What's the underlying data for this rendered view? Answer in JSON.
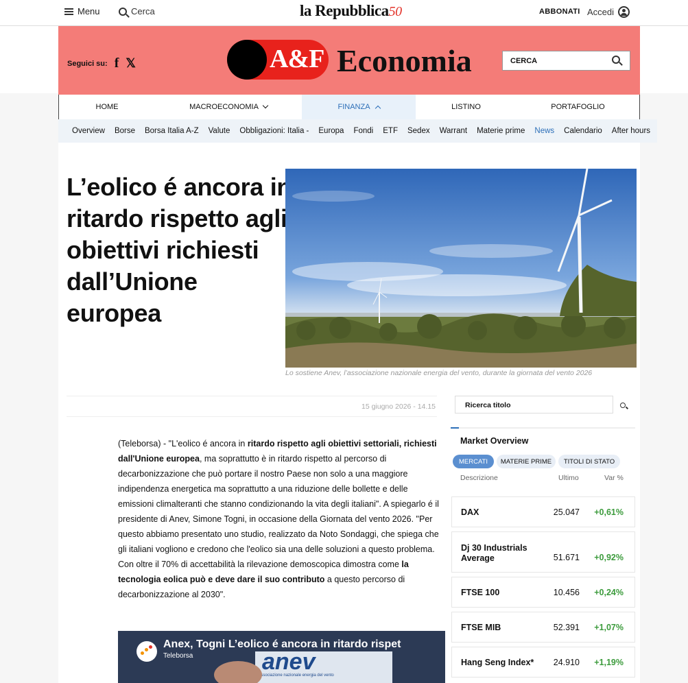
{
  "topbar": {
    "menu_label": "Menu",
    "search_label": "Cerca",
    "logo_text": "la Repubblica",
    "logo_suffix": "50",
    "subscribe_label": "ABBONATI",
    "login_label": "Accedi"
  },
  "section_header": {
    "follow_label": "Seguici su:",
    "facebook_glyph": "f",
    "x_glyph": "𝕏",
    "brand_mark": "A&F",
    "brand_name": "Economia",
    "search_placeholder": "CERCA"
  },
  "main_nav": [
    {
      "label": "HOME",
      "dropdown": false,
      "active": false
    },
    {
      "label": "MACROECONOMIA",
      "dropdown": true,
      "active": false
    },
    {
      "label": "FINANZA",
      "dropdown": true,
      "active": true
    },
    {
      "label": "LISTINO",
      "dropdown": false,
      "active": false
    },
    {
      "label": "PORTAFOGLIO",
      "dropdown": false,
      "active": false
    }
  ],
  "sub_nav": [
    "Overview",
    "Borse",
    "Borsa Italia A-Z",
    "Valute",
    "Obbligazioni: Italia -",
    "Europa",
    "Fondi",
    "ETF",
    "Sedex",
    "Warrant",
    "Materie prime",
    "News",
    "Calendario",
    "After hours"
  ],
  "sub_nav_active": "News",
  "article": {
    "title": "L’eolico é ancora in ritardo rispetto agli obiettivi richiesti dall’Unione europea",
    "image_caption": "Lo sostiene Anev, l’associazione nazionale energia del vento, durante la giornata del vento 2026",
    "date": "15 giugno 2026 - 14.15",
    "body": [
      {
        "t": "(Teleborsa) - \"L'eolico é ancora in ",
        "b": false
      },
      {
        "t": "ritardo rispetto agli obiettivi settoriali, richiesti dall'Unione europea",
        "b": true
      },
      {
        "t": ", ma soprattutto è in ritardo rispetto al percorso di decarbonizzazione che può portare il nostro Paese non solo a una maggiore indipendenza energetica ma soprattutto a una riduzione delle bollette e delle emissioni climalteranti che stanno condizionando la vita degli italiani\". A spiegarlo é il presidente di Anev, Simone Togni, in occasione della Giornata del vento 2026. \"Per questo abbiamo presentato uno studio, realizzato da Noto Sondaggi, che spiega che gli italiani vogliono e credono che l'eolico sia una delle soluzioni a questo problema. Con oltre il 70% di accettabilità la rilevazione demoscopica dimostra come ",
        "b": false
      },
      {
        "t": "la tecnologia eolica può e deve dare il suo contributo",
        "b": true
      },
      {
        "t": " a questo percorso di decarbonizzazione al 2030\".",
        "b": false
      }
    ],
    "video": {
      "title": "Anex, Togni L’eolico é ancora in ritardo rispet",
      "channel": "Teleborsa",
      "sign_text": "anev",
      "sign_sub": "associazione nazionale energia del vento"
    }
  },
  "sidebar": {
    "search_placeholder": "Ricerca titolo",
    "market_title": "Market Overview",
    "tabs": [
      {
        "label": "MERCATI",
        "active": true
      },
      {
        "label": "MATERIE PRIME",
        "active": false
      },
      {
        "label": "TITOLI DI STATO",
        "active": false
      }
    ],
    "columns": [
      "Descrizione",
      "Ultimo",
      "Var %"
    ],
    "rows": [
      {
        "name": "DAX",
        "last": "25.047",
        "change": "+0,61%"
      },
      {
        "name": "Dj 30 Industrials Average",
        "last": "51.671",
        "change": "+0,92%"
      },
      {
        "name": "FTSE 100",
        "last": "10.456",
        "change": "+0,24%"
      },
      {
        "name": "FTSE MIB",
        "last": "52.391",
        "change": "+1,07%"
      },
      {
        "name": "Hang Seng Index*",
        "last": "24.910",
        "change": "+1,19%"
      }
    ],
    "positive_color": "#3c9b3c"
  },
  "colors": {
    "header_bg": "#f47c78",
    "accent": "#2d6fb8",
    "brand_red": "#e8221c"
  }
}
